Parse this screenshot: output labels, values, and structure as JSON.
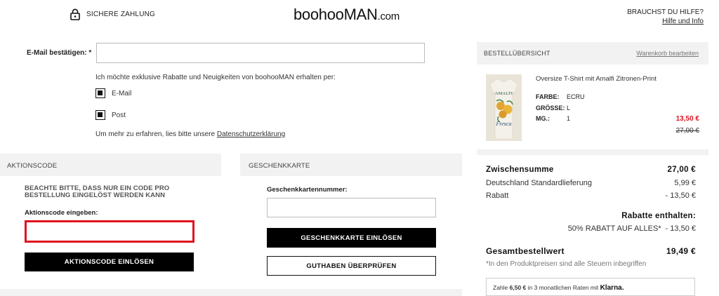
{
  "header": {
    "secure_label": "SICHERE ZAHLUNG",
    "logo": "boohooMAN",
    "logo_suffix": ".com",
    "help_title": "BRAUCHST DU HILFE?",
    "help_link": "Hilfe und Info"
  },
  "email": {
    "label": "E-Mail bestätigen: *",
    "value": "",
    "optin_text": "Ich möchte exklusive Rabatte und Neuigkeiten von boohooMAN erhalten per:",
    "options": [
      {
        "label": "E-Mail",
        "checked": true
      },
      {
        "label": "Post",
        "checked": true
      }
    ],
    "privacy_text": "Um mehr zu erfahren, lies bitte unsere ",
    "privacy_link": "Datenschutzerklärung"
  },
  "promo": {
    "header": "AKTIONSCODE",
    "note": "BEACHTE BITTE, DASS NUR EIN CODE PRO BESTELLUNG EINGELÖST WERDEN KANN",
    "input_label": "Aktionscode eingeben:",
    "input_value": "",
    "button": "AKTIONSCODE EINLÖSEN"
  },
  "gift": {
    "header": "GESCHENKKARTE",
    "input_label": "Geschenkkartennummer:",
    "input_value": "",
    "redeem_button": "GESCHENKKARTE EINLÖSEN",
    "check_button": "GUTHABEN ÜBERPRÜFEN"
  },
  "summary": {
    "header": "BESTELLÜBERSICHT",
    "edit_link": "Warenkorb bearbeiten",
    "product": {
      "title": "Oversize T-Shirt mit Amalfi Zitronen-Print",
      "attributes": [
        {
          "key": "FARBE:",
          "value": "ECRU"
        },
        {
          "key": "GRÖSSE:",
          "value": "L"
        },
        {
          "key": "MG.:",
          "value": "1"
        }
      ],
      "sale_price": "13,50 €",
      "old_price": "27,00 €",
      "print_lines": [
        "AMALFI",
        "Fresca"
      ]
    },
    "subtotal_label": "Zwischensumme",
    "subtotal_value": "27,00 €",
    "shipping_label": "Deutschland Standardlieferung",
    "shipping_value": "5,99 €",
    "discount_label": "Rabatt",
    "discount_value": "- 13,50 €",
    "discount_included_label": "Rabatte enthalten:",
    "discount_detail_label": "50% RABATT AUF ALLES*",
    "discount_detail_value": "- 13,50 €",
    "total_label": "Gesamtbestellwert",
    "total_value": "19,49 €",
    "tax_note": "*In den Produktpreisen sind alle Steuern inbegriffen",
    "klarna": {
      "prefix": "Zahle ",
      "amount": "6,50 €",
      "middle": " in 3 monatlichen Raten mit ",
      "brand": "Klarna."
    }
  }
}
